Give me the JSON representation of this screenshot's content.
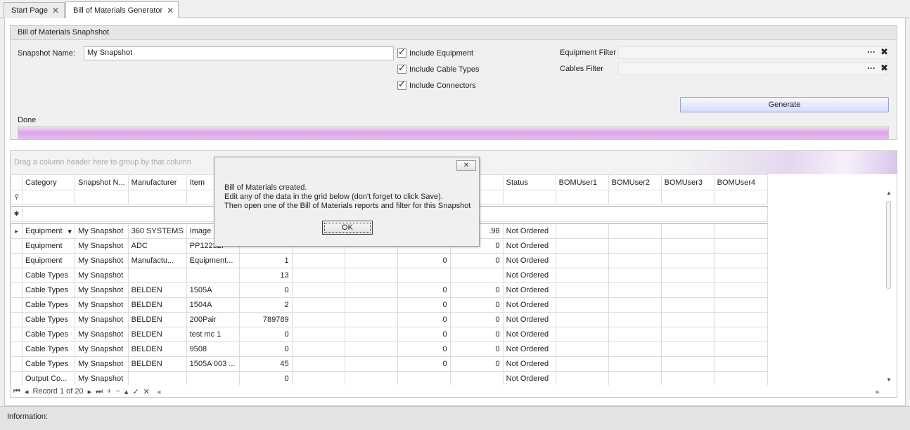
{
  "tabs": [
    {
      "label": "Start Page",
      "close": "✕"
    },
    {
      "label": "Bill of Materials Generator",
      "close": "✕"
    }
  ],
  "snapshot": {
    "group_title": "Bill of Materials Snaphshot",
    "name_label": "Snapshot Name:",
    "name_value": "My Snapshot",
    "include_equipment": "Include Equipment",
    "include_cable_types": "Include Cable Types",
    "include_connectors": "Include Connectors",
    "equipment_filter_label": "Equipment Filter",
    "cables_filter_label": "Cables Filter",
    "ellipsis": "···",
    "clear": "✖",
    "generate_label": "Generate",
    "status_text": "Done",
    "progress_fraction": 1.0,
    "progress_color": "#dfa3ea"
  },
  "grid": {
    "group_hint": "Drag a column header here to group by that column",
    "columns": [
      "Category",
      "Snapshot N...",
      "Manufacturer",
      "Item",
      "",
      "",
      "",
      "",
      "",
      "Status",
      "BOMUser1",
      "BOMUser2",
      "BOMUser3",
      "BOMUser4"
    ],
    "rows": [
      [
        "Equipment",
        "My Snapshot",
        "360 SYSTEMS",
        "Image Se",
        "",
        "",
        "",
        "",
        ".98",
        "Not Ordered",
        "",
        "",
        "",
        ""
      ],
      [
        "Equipment",
        "My Snapshot",
        "ADC",
        "PP12232I",
        "",
        "",
        "",
        "",
        "0",
        "Not Ordered",
        "",
        "",
        "",
        ""
      ],
      [
        "Equipment",
        "My Snapshot",
        "Manufactu...",
        "Equipment...",
        "1",
        "",
        "",
        "0",
        "0",
        "Not Ordered",
        "",
        "",
        "",
        ""
      ],
      [
        "Cable Types",
        "My Snapshot",
        "",
        "",
        "13",
        "",
        "",
        "",
        "",
        "Not Ordered",
        "",
        "",
        "",
        ""
      ],
      [
        "Cable Types",
        "My Snapshot",
        "BELDEN",
        "1505A",
        "0",
        "",
        "",
        "0",
        "0",
        "Not Ordered",
        "",
        "",
        "",
        ""
      ],
      [
        "Cable Types",
        "My Snapshot",
        "BELDEN",
        "1504A",
        "2",
        "",
        "",
        "0",
        "0",
        "Not Ordered",
        "",
        "",
        "",
        ""
      ],
      [
        "Cable Types",
        "My Snapshot",
        "BELDEN",
        "200Pair",
        "789789",
        "",
        "",
        "0",
        "0",
        "Not Ordered",
        "",
        "",
        "",
        ""
      ],
      [
        "Cable Types",
        "My Snapshot",
        "BELDEN",
        "test mc 1",
        "0",
        "",
        "",
        "0",
        "0",
        "Not Ordered",
        "",
        "",
        "",
        ""
      ],
      [
        "Cable Types",
        "My Snapshot",
        "BELDEN",
        "9508",
        "0",
        "",
        "",
        "0",
        "0",
        "Not Ordered",
        "",
        "",
        "",
        ""
      ],
      [
        "Cable Types",
        "My Snapshot",
        "BELDEN",
        "1505A 003 ...",
        "45",
        "",
        "",
        "0",
        "0",
        "Not Ordered",
        "",
        "",
        "",
        ""
      ],
      [
        "Output Co...",
        "My Snapshot",
        "",
        "",
        "0",
        "",
        "",
        "",
        "",
        "Not Ordered",
        "",
        "",
        "",
        ""
      ]
    ],
    "record_text": "Record 1 of 20",
    "nav_buttons": [
      "⏮",
      "◂",
      "▸",
      "⏭",
      "+",
      "−",
      "▴",
      "✓",
      "✕"
    ],
    "filter_row_icon": "⚲",
    "new_row_icon": "✱",
    "current_row_icon": "▸"
  },
  "info": {
    "label": "Information:"
  },
  "dialog": {
    "close": "✕",
    "line1": "Bill of Materials created.",
    "line2": "Edit any of the data in the grid below (don't forget to click Save).",
    "line3": "Then open one of the Bill of Materials reports and filter for this Snapshot",
    "ok_label": "OK"
  }
}
